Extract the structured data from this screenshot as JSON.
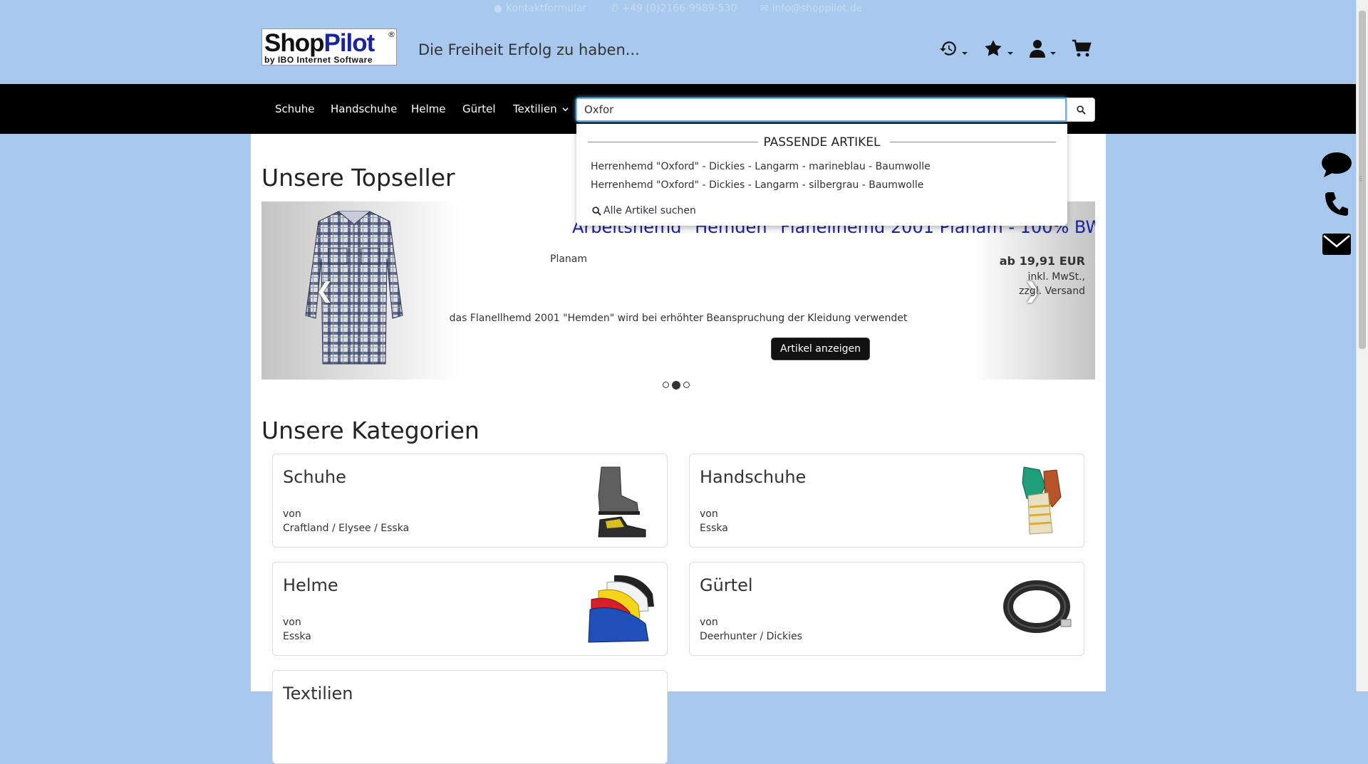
{
  "topbar": {
    "contact_form": "Kontaktformular",
    "phone": "+49 (0)2166-9989-530",
    "email": "info@shoppilot.de"
  },
  "header": {
    "logo_shop": "Shop",
    "logo_pilot": "Pilot",
    "logo_reg": "®",
    "logo_sub": "by IBO Internet Software",
    "slogan": "Die Freiheit Erfolg zu haben..."
  },
  "nav": {
    "items": [
      "Schuhe",
      "Handschuhe",
      "Helme",
      "Gürtel",
      "Textilien"
    ]
  },
  "search": {
    "value": "Oxfor",
    "placeholder": ""
  },
  "dropdown": {
    "heading": "PASSENDE ARTIKEL",
    "results": [
      "Herrenhemd \"Oxford\" - Dickies - Langarm - marineblau - Baumwolle",
      "Herrenhemd \"Oxford\" - Dickies - Langarm - silbergrau - Baumwolle"
    ],
    "all_label": "Alle Artikel suchen"
  },
  "topseller": {
    "heading": "Unsere Topseller",
    "product": {
      "title": "Arbeitshemd \"Hemden\" Flanellhemd 2001 Planam - 100% BW",
      "brand": "Planam",
      "price": "ab 19,91 EUR",
      "tax_line1": "inkl. MwSt.,",
      "tax_line2": "zzgl. Versand",
      "description": "das Flanellhemd 2001 \"Hemden\" wird bei erhöhter Beanspruchung der Kleidung verwendet",
      "button": "Artikel anzeigen"
    },
    "slide_count": 3,
    "active_slide": 2
  },
  "categories": {
    "heading": "Unsere Kategorien",
    "von": "von",
    "items": [
      {
        "name": "Schuhe",
        "brands": "Craftland / Elysee / Esska"
      },
      {
        "name": "Handschuhe",
        "brands": "Esska"
      },
      {
        "name": "Helme",
        "brands": "Esska"
      },
      {
        "name": "Gürtel",
        "brands": "Deerhunter / Dickies"
      },
      {
        "name": "Textilien",
        "brands": ""
      }
    ]
  },
  "colors": {
    "page_bg": "#a8c8ee",
    "navbar": "#000000",
    "title_blue": "#1a23a0",
    "focus": "#66afe9"
  },
  "icons": {
    "header": [
      "history-icon",
      "star-icon",
      "user-icon",
      "cart-icon"
    ],
    "side": [
      "chat-icon",
      "phone-icon",
      "envelope-icon"
    ]
  }
}
